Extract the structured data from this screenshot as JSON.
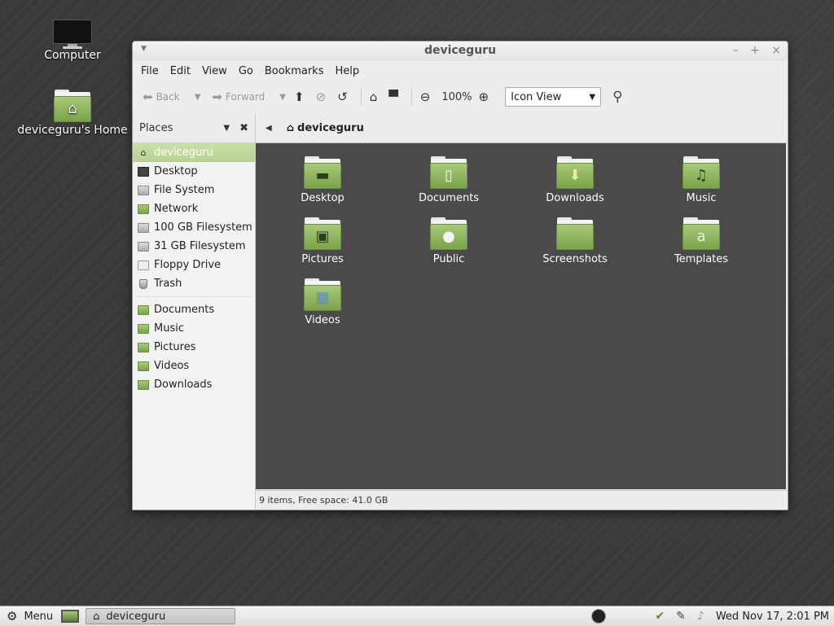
{
  "desktop": {
    "icons": [
      {
        "label": "Computer"
      },
      {
        "label": "deviceguru's Home"
      }
    ]
  },
  "window": {
    "title": "deviceguru",
    "menu": [
      "File",
      "Edit",
      "View",
      "Go",
      "Bookmarks",
      "Help"
    ],
    "toolbar": {
      "back": "Back",
      "forward": "Forward",
      "zoom": "100%",
      "view_mode": "Icon View"
    },
    "sidebar": {
      "title": "Places",
      "places": [
        {
          "label": "deviceguru",
          "icon": "home-icon"
        },
        {
          "label": "Desktop",
          "icon": "desktop-icon"
        },
        {
          "label": "File System",
          "icon": "drive-icon"
        },
        {
          "label": "Network",
          "icon": "network-icon"
        },
        {
          "label": "100 GB Filesystem",
          "icon": "drive-icon"
        },
        {
          "label": "31 GB Filesystem",
          "icon": "drive-icon"
        },
        {
          "label": "Floppy Drive",
          "icon": "floppy-icon"
        },
        {
          "label": "Trash",
          "icon": "trash-icon"
        }
      ],
      "bookmarks": [
        {
          "label": "Documents",
          "icon": "folder-documents-icon"
        },
        {
          "label": "Music",
          "icon": "folder-music-icon"
        },
        {
          "label": "Pictures",
          "icon": "folder-pictures-icon"
        },
        {
          "label": "Videos",
          "icon": "folder-videos-icon"
        },
        {
          "label": "Downloads",
          "icon": "folder-downloads-icon"
        }
      ]
    },
    "path": {
      "current": "deviceguru"
    },
    "items": [
      {
        "label": "Desktop",
        "emblem": "▬"
      },
      {
        "label": "Documents",
        "emblem": "▯"
      },
      {
        "label": "Downloads",
        "emblem": "⬇"
      },
      {
        "label": "Music",
        "emblem": "♫"
      },
      {
        "label": "Pictures",
        "emblem": "▣"
      },
      {
        "label": "Public",
        "emblem": "●"
      },
      {
        "label": "Screenshots",
        "emblem": ""
      },
      {
        "label": "Templates",
        "emblem": "a"
      },
      {
        "label": "Videos",
        "emblem": "▦"
      }
    ],
    "status": "9 items, Free space: 41.0 GB"
  },
  "panel": {
    "menu_label": "Menu",
    "task_label": "deviceguru",
    "clock": "Wed Nov 17,  2:01 PM"
  },
  "colors": {
    "accent": "#8cb25a",
    "selection": "#b8d294",
    "content_bg": "#4a4a4a"
  }
}
